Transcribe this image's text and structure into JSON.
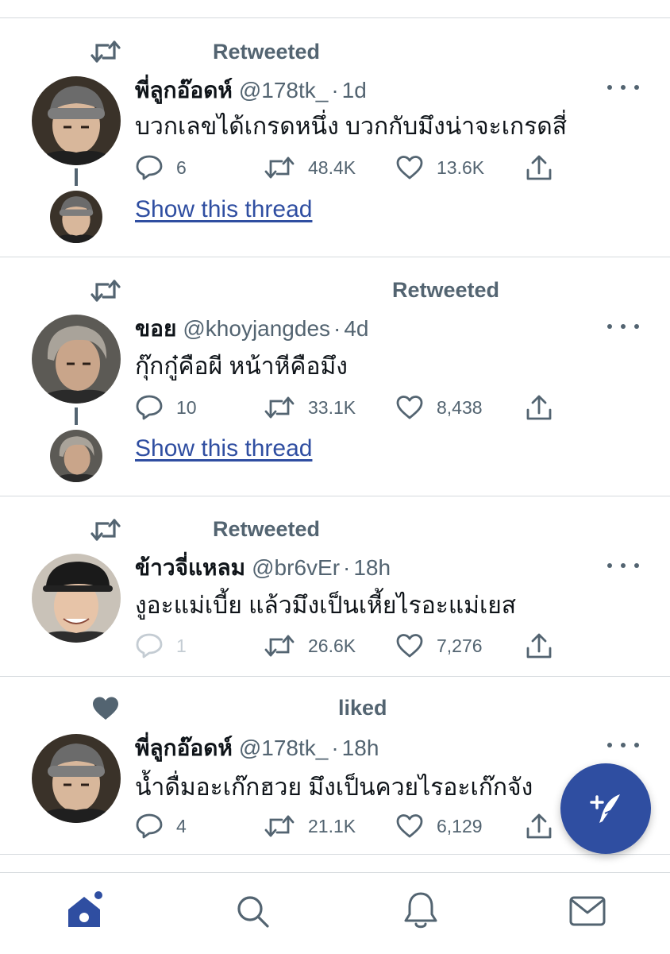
{
  "tweets": [
    {
      "context": "Retweeted",
      "context_type": "retweet",
      "name": "พี่ลูกอ๊อดห์",
      "handle": "@178tk_",
      "time": "1d",
      "text": "บวกเลขได้เกรดหนึ่ง บวกกับมึงน่าจะเกรดสี่",
      "replies": "6",
      "retweets": "48.4K",
      "likes": "13.6K",
      "show_thread": "Show this thread"
    },
    {
      "context": "Retweeted",
      "context_type": "retweet",
      "name": "ขอย",
      "handle": "@khoyjangdes",
      "time": "4d",
      "text": "กุ๊กกู๋คือผี หน้าหีคือมึง",
      "replies": "10",
      "retweets": "33.1K",
      "likes": "8,438",
      "show_thread": "Show this thread"
    },
    {
      "context": "Retweeted",
      "context_type": "retweet",
      "name": "ข้าวจี่แหลม",
      "handle": "@br6vEr",
      "time": "18h",
      "text": "งูอะแม่เบี้ย แล้วมึงเป็นเหี้ยไรอะแม่เยส",
      "replies": "1",
      "retweets": "26.6K",
      "likes": "7,276"
    },
    {
      "context": "liked",
      "context_type": "like",
      "name": "พี่ลูกอ๊อดห์",
      "handle": "@178tk_",
      "time": "18h",
      "text": "น้ำดื่มอะเก๊กฮวย มึงเป็นควยไรอะเก๊กจัง",
      "replies": "4",
      "retweets": "21.1K",
      "likes": "6,129"
    }
  ],
  "separator": "·",
  "icons": {
    "reply": "reply-icon",
    "retweet": "retweet-icon",
    "like": "heart-icon",
    "share": "share-icon",
    "more": "more-icon",
    "compose": "compose-tweet-icon",
    "tabs": [
      "home-icon",
      "search-icon",
      "notifications-icon",
      "messages-icon"
    ]
  },
  "colors": {
    "accent": "#2f4ea1",
    "muted": "#536471",
    "text": "#0f1419",
    "divider": "#d6dade"
  }
}
